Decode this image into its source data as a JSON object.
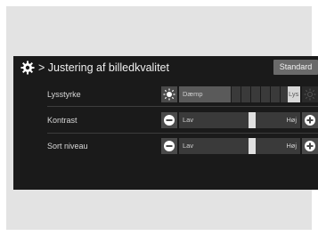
{
  "header": {
    "title": "Justering af billedkvalitet",
    "standard_button": "Standard"
  },
  "settings": [
    {
      "label": "Lysstyrke",
      "low_label": "Dæmp",
      "high_label": "Lys",
      "level": 0.95
    },
    {
      "label": "Kontrast",
      "low_label": "Lav",
      "high_label": "Høj",
      "level": 0.5
    },
    {
      "label": "Sort niveau",
      "low_label": "Lav",
      "high_label": "Høj",
      "level": 0.5
    }
  ],
  "icons": {
    "settings": "gear-icon",
    "breadcrumb": "chevron-right-icon",
    "brightness_low": "sun-icon",
    "brightness_high": "sun-outline-icon",
    "decrease": "minus-circle-icon",
    "increase": "plus-circle-icon"
  },
  "colors": {
    "screen_background": "#1a1a1a",
    "text": "#d8d8d8",
    "button": "#6a6a6a",
    "slider_thumb": "#e0e0e0"
  }
}
